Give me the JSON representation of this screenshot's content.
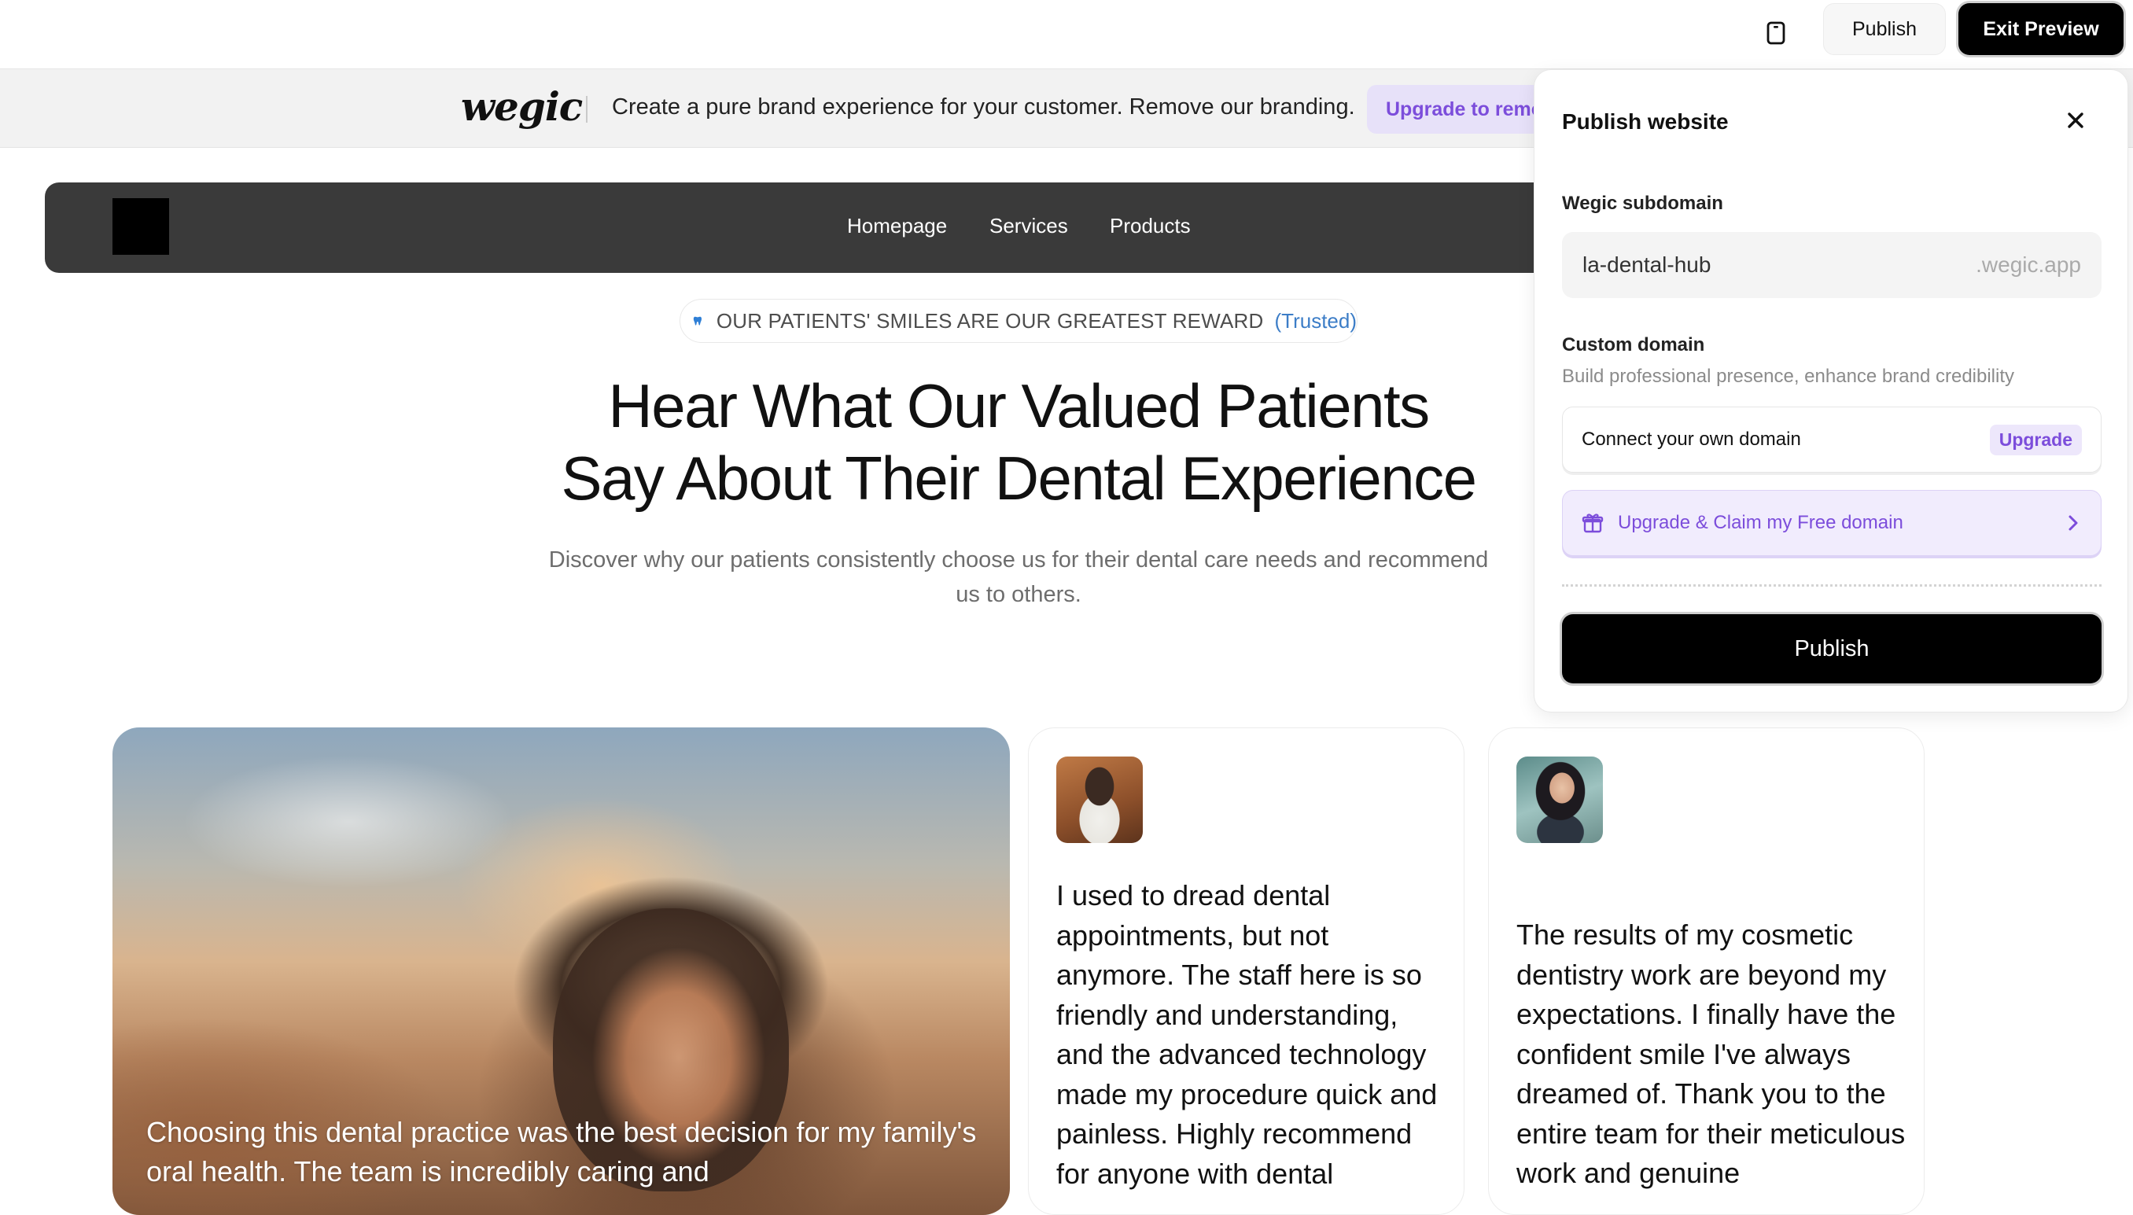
{
  "toolbar": {
    "device_icon": "mobile-device-icon",
    "publish_label": "Publish",
    "exit_preview_label": "Exit Preview"
  },
  "banner": {
    "logo_text": "wegic",
    "message": "Create a pure brand experience for your customer. Remove our branding.",
    "upgrade_label": "Upgrade to remove"
  },
  "site_nav": {
    "links": [
      "Homepage",
      "Services",
      "Products"
    ]
  },
  "hero": {
    "tag_icon": "tooth-icon",
    "tag_text": "OUR PATIENTS' SMILES ARE OUR GREATEST REWARD",
    "tag_trusted": "(Trusted)",
    "title_line1": "Hear What Our Valued Patients",
    "title_line2": "Say About Their Dental Experience",
    "subtitle": "Discover why our patients consistently choose us for their dental care needs and recommend us to others."
  },
  "testimonials": [
    {
      "quote": "Choosing this dental practice was the best decision for my family's oral health. The team is incredibly caring and"
    },
    {
      "quote": "I used to dread dental appointments, but not anymore. The staff here is so friendly and understanding, and the advanced technology made my procedure quick and painless. Highly recommend for anyone with dental"
    },
    {
      "quote": "The results of my cosmetic dentistry work are beyond my expectations. I finally have the confident smile I've always dreamed of. Thank you to the entire team for their meticulous work and genuine"
    }
  ],
  "publish_panel": {
    "title": "Publish website",
    "subdomain_label": "Wegic subdomain",
    "subdomain_value": "la-dental-hub",
    "subdomain_suffix": ".wegic.app",
    "custom_domain_label": "Custom domain",
    "custom_domain_hint": "Build professional presence, enhance brand credibility",
    "connect_domain_label": "Connect your own domain",
    "upgrade_badge": "Upgrade",
    "claim_label": "Upgrade & Claim my Free domain",
    "publish_button": "Publish"
  },
  "colors": {
    "accent_purple": "#7c4ddb",
    "nav_bg": "#3a3a3a",
    "trusted_blue": "#3c7dc7"
  }
}
